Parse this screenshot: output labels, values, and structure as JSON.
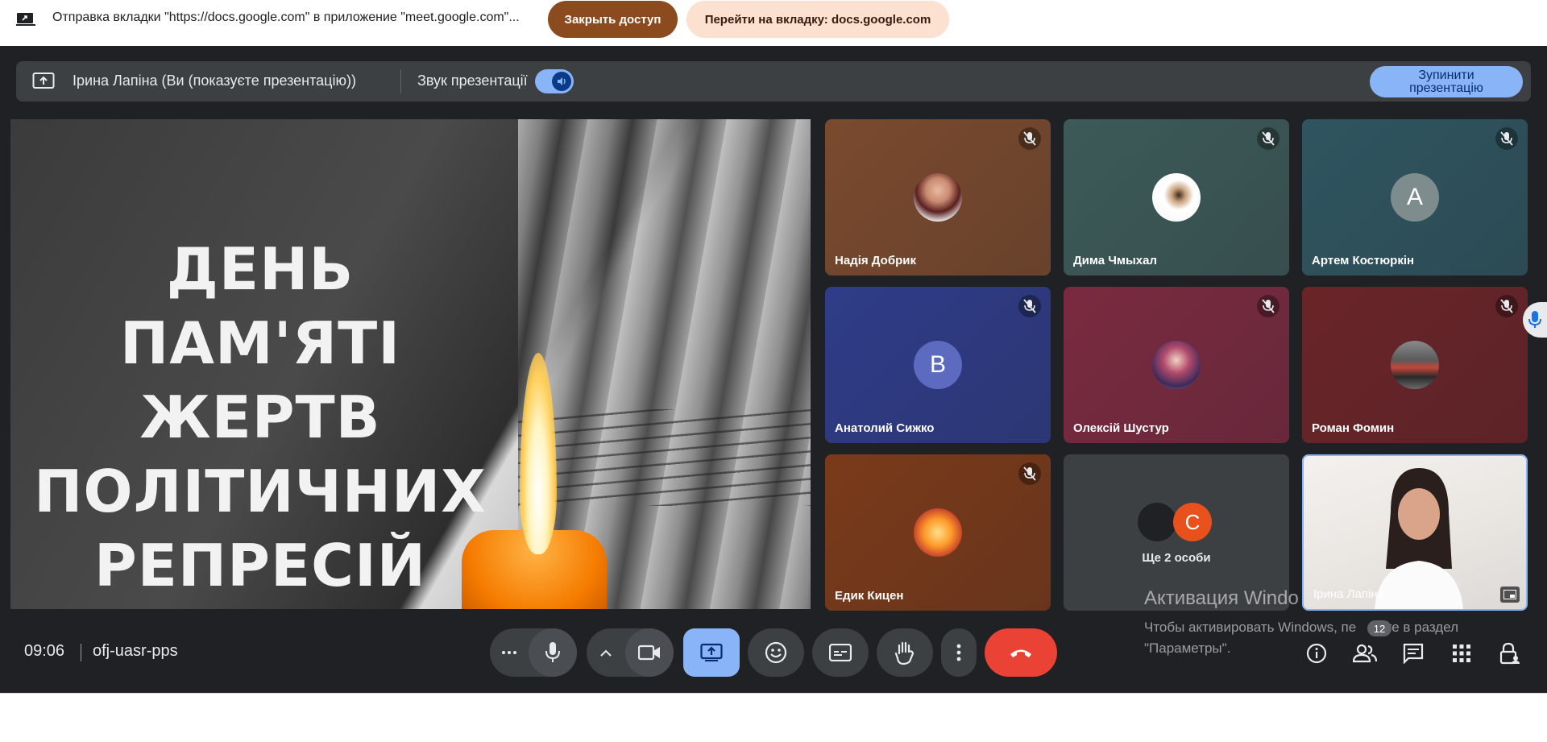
{
  "share_bar": {
    "message": "Отправка вкладки \"https://docs.google.com\" в приложение \"meet.google.com\"...",
    "stop_sharing_label": "Закрыть доступ",
    "switch_tab_label": "Перейти на вкладку: docs.google.com"
  },
  "presentation_bar": {
    "presenter": "Ірина Лапіна (Ви (показуєте презентацію))",
    "audio_label": "Звук презентації",
    "audio_on": true,
    "stop_label": "Зупинити\nпрезентацію"
  },
  "slide": {
    "lines": [
      "ДЕНЬ",
      "ПАМ'ЯТІ ЖЕРТВ",
      "ПОЛІТИЧНИХ",
      "РЕПРЕСІЙ"
    ]
  },
  "participants": [
    {
      "name": "Надія Добрик",
      "avatar": "photo",
      "muted": true,
      "bg": "#7a4a2e"
    },
    {
      "name": "Дима Чмыхал",
      "avatar": "photo",
      "muted": true,
      "bg": "#3c5a58"
    },
    {
      "name": "Артем Костюркін",
      "avatar": "A",
      "muted": true,
      "bg": "#2f5560"
    },
    {
      "name": "Анатолий Сижко",
      "avatar": "В",
      "muted": true,
      "bg": "#2f3c88"
    },
    {
      "name": "Олексій Шустур",
      "avatar": "photo",
      "muted": true,
      "bg": "#7a2a40"
    },
    {
      "name": "Роман Фомин",
      "avatar": "photo",
      "muted": true,
      "bg": "#6a2428"
    },
    {
      "name": "Едик Кицен",
      "avatar": "photo",
      "muted": true,
      "bg": "#7a3a1a"
    }
  ],
  "more_people": {
    "label": "Ще 2 особи",
    "initial": "С"
  },
  "self_tile": {
    "name": "Ірина Лапіна"
  },
  "watermark": {
    "title": "Активация Windo",
    "line1": "Чтобы активировать Windows, пе  дите в раздел",
    "line2": "\"Параметры\"."
  },
  "bottom_bar": {
    "time": "09:06",
    "meeting_code": "ofj-uasr-pps",
    "participant_count": "12"
  },
  "colors": {
    "accent": "#8ab4f8",
    "end_call": "#ea4335",
    "meet_bg": "#202124"
  }
}
